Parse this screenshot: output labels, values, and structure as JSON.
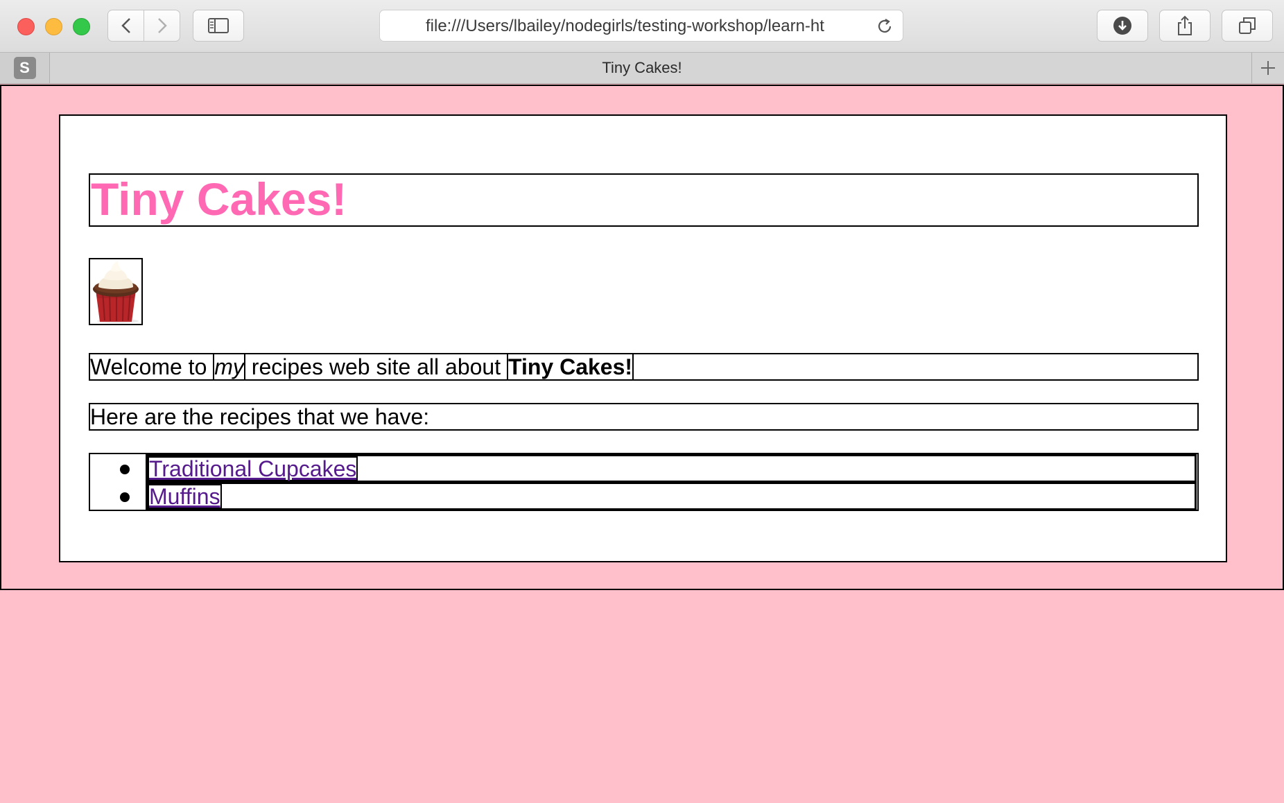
{
  "browser": {
    "url": "file:///Users/lbailey/nodegirls/testing-workshop/learn-ht",
    "tab_title": "Tiny Cakes!",
    "pinned_tab_letter": "S"
  },
  "page": {
    "heading": "Tiny Cakes!",
    "image_alt": "cupcake",
    "intro": {
      "part1": "Welcome to ",
      "emphasis": "my",
      "part2": " recipes web site all about ",
      "strong": "Tiny Cakes!"
    },
    "recipes_intro": "Here are the recipes that we have:",
    "recipes": [
      {
        "label": "Traditional Cupcakes"
      },
      {
        "label": "Muffins"
      }
    ]
  },
  "colors": {
    "page_background": "#ffc0cb",
    "heading": "#ff69b4",
    "link_visited": "#551a8b"
  }
}
